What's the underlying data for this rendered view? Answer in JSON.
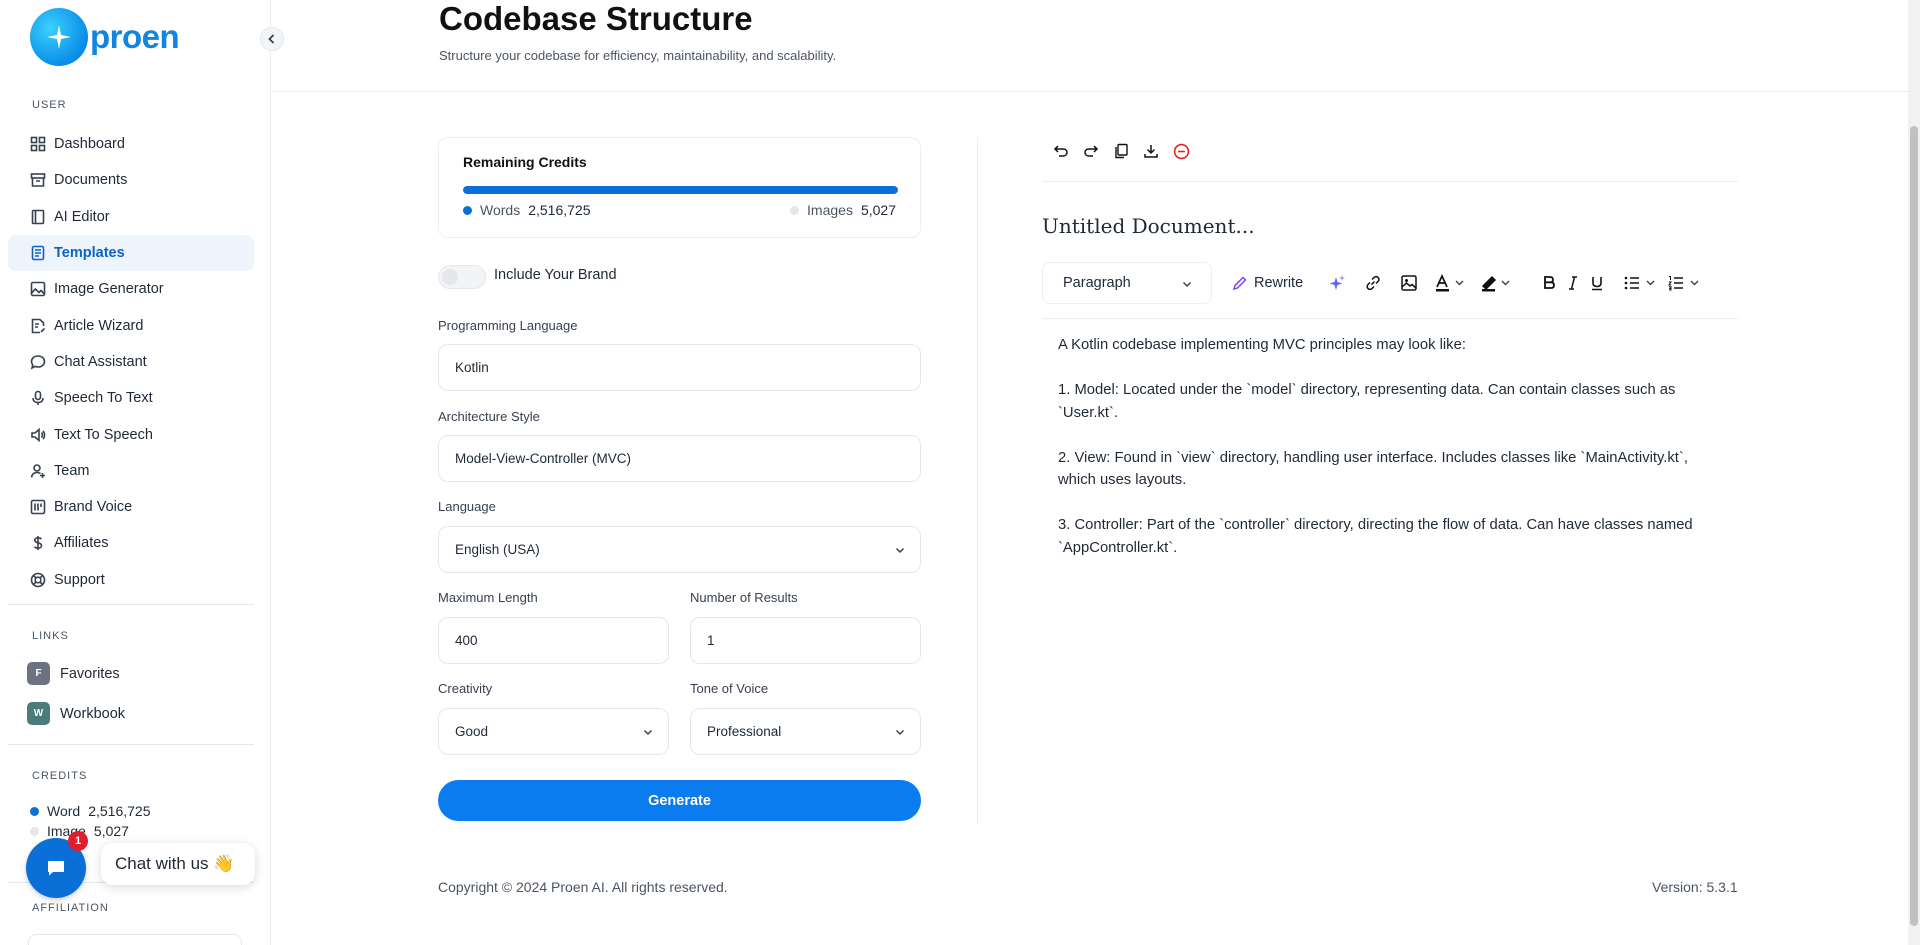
{
  "brand": {
    "name": "proen",
    "accent": "#0b7bf0"
  },
  "sidebar": {
    "user_label": "USER",
    "items": [
      {
        "label": "Dashboard",
        "icon": "grid-icon"
      },
      {
        "label": "Documents",
        "icon": "archive-icon"
      },
      {
        "label": "AI Editor",
        "icon": "book-icon"
      },
      {
        "label": "Templates",
        "icon": "file-icon",
        "active": true
      },
      {
        "label": "Image Generator",
        "icon": "image-icon"
      },
      {
        "label": "Article Wizard",
        "icon": "file-edit-icon"
      },
      {
        "label": "Chat Assistant",
        "icon": "chat-icon"
      },
      {
        "label": "Speech To Text",
        "icon": "mic-icon"
      },
      {
        "label": "Text To Speech",
        "icon": "speaker-icon"
      },
      {
        "label": "Team",
        "icon": "user-icon"
      },
      {
        "label": "Brand Voice",
        "icon": "brand-icon"
      },
      {
        "label": "Affiliates",
        "icon": "dollar-icon"
      },
      {
        "label": "Support",
        "icon": "lifebuoy-icon"
      }
    ],
    "links_label": "LINKS",
    "links": [
      {
        "badge": "F",
        "label": "Favorites",
        "color": "#6b7280"
      },
      {
        "badge": "W",
        "label": "Workbook",
        "color": "#4b7b7b"
      }
    ],
    "credits_label": "CREDITS",
    "credits": [
      {
        "label": "Word",
        "value": "2,516,725",
        "color": "#0b6fd8"
      },
      {
        "label": "Image",
        "value": "5,027",
        "color": "#e5e7eb"
      }
    ],
    "affiliation_label": "AFFILIATION"
  },
  "chat": {
    "badge": "1",
    "label": "Chat with us 👋"
  },
  "header": {
    "title": "Codebase Structure",
    "subtitle": "Structure your codebase for efficiency, maintainability, and scalability."
  },
  "form": {
    "credits": {
      "title": "Remaining Credits",
      "words_label": "Words",
      "words_value": "2,516,725",
      "images_label": "Images",
      "images_value": "5,027",
      "progress_fraction": 1.0
    },
    "brand_toggle": {
      "label": "Include Your Brand",
      "on": false
    },
    "programming_language": {
      "label": "Programming Language",
      "value": "Kotlin"
    },
    "architecture_style": {
      "label": "Architecture Style",
      "value": "Model-View-Controller (MVC)"
    },
    "language": {
      "label": "Language",
      "value": "English (USA)"
    },
    "max_length": {
      "label": "Maximum Length",
      "value": "400"
    },
    "num_results": {
      "label": "Number of Results",
      "value": "1"
    },
    "creativity": {
      "label": "Creativity",
      "value": "Good"
    },
    "tone": {
      "label": "Tone of Voice",
      "value": "Professional"
    },
    "generate_label": "Generate"
  },
  "editor": {
    "doc_title": "Untitled Document...",
    "paragraph_select": "Paragraph",
    "rewrite_label": "Rewrite",
    "content": [
      "A Kotlin codebase implementing MVC principles may look like:",
      "1. Model: Located under the `model` directory, representing data. Can contain classes such as `User.kt`.",
      "2. View: Found in `view` directory, handling user interface. Includes classes like `MainActivity.kt`, which uses layouts.",
      "3. Controller: Part of the `controller` directory, directing the flow of data. Can have classes named `AppController.kt`."
    ]
  },
  "footer": {
    "copyright": "Copyright © 2024 Proen AI. All rights reserved.",
    "version": "Version: 5.3.1"
  }
}
